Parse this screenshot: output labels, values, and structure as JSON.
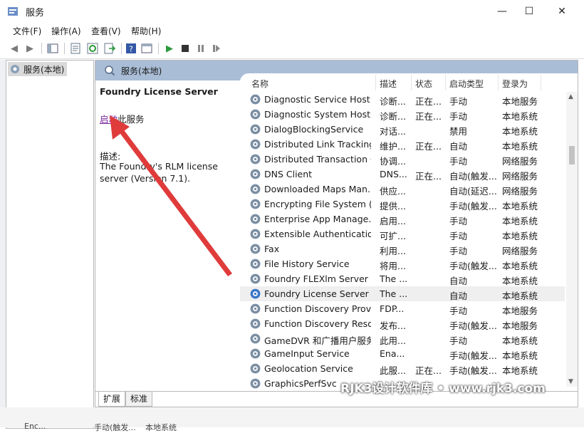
{
  "window": {
    "title": "服务",
    "minimize_glyph": "—",
    "maximize_glyph": "☐",
    "close_glyph": "✕"
  },
  "menu": [
    {
      "label": "文件(F)"
    },
    {
      "label": "操作(A)"
    },
    {
      "label": "查看(V)"
    },
    {
      "label": "帮助(H)"
    }
  ],
  "toolbar": {
    "icons": [
      "back-arrow-icon",
      "forward-arrow-icon",
      "console-tree-icon",
      "properties-icon",
      "refresh-icon",
      "export-list-icon",
      "help-icon",
      "view-icon",
      "start-service-icon",
      "stop-service-icon",
      "pause-service-icon",
      "restart-service-icon"
    ]
  },
  "tree": {
    "root_label": "服务(本地)"
  },
  "main": {
    "header_title": "服务(本地)",
    "detail": {
      "service_name": "Foundry License Server",
      "action_link": "启动",
      "action_suffix": "此服务",
      "desc_label": "描述:",
      "desc_text": "The Foundry's RLM license server (Version 7.1)."
    },
    "columns": {
      "name": "名称",
      "desc": "描述",
      "status": "状态",
      "startup": "启动类型",
      "logon": "登录为"
    },
    "rows": [
      {
        "name": "Diagnostic Service Host",
        "desc": "诊断...",
        "status": "正在...",
        "startup": "手动",
        "logon": "本地服务"
      },
      {
        "name": "Diagnostic System Host",
        "desc": "诊断...",
        "status": "正在...",
        "startup": "手动",
        "logon": "本地系统"
      },
      {
        "name": "DialogBlockingService",
        "desc": "对话...",
        "status": "",
        "startup": "禁用",
        "logon": "本地系统"
      },
      {
        "name": "Distributed Link Tracking...",
        "desc": "维护...",
        "status": "正在...",
        "startup": "自动",
        "logon": "本地系统"
      },
      {
        "name": "Distributed Transaction C...",
        "desc": "协调...",
        "status": "",
        "startup": "手动",
        "logon": "网络服务"
      },
      {
        "name": "DNS Client",
        "desc": "DNS...",
        "status": "正在...",
        "startup": "自动(触发...",
        "logon": "网络服务"
      },
      {
        "name": "Downloaded Maps Man...",
        "desc": "供应...",
        "status": "",
        "startup": "自动(延迟...",
        "logon": "网络服务"
      },
      {
        "name": "Encrypting File System (E...",
        "desc": "提供...",
        "status": "",
        "startup": "手动(触发...",
        "logon": "本地系统"
      },
      {
        "name": "Enterprise App Manage...",
        "desc": "启用...",
        "status": "",
        "startup": "手动",
        "logon": "本地系统"
      },
      {
        "name": "Extensible Authentication...",
        "desc": "可扩...",
        "status": "",
        "startup": "手动",
        "logon": "本地系统"
      },
      {
        "name": "Fax",
        "desc": "利用...",
        "status": "",
        "startup": "手动",
        "logon": "网络服务"
      },
      {
        "name": "File History Service",
        "desc": "将用...",
        "status": "",
        "startup": "手动(触发...",
        "logon": "本地系统"
      },
      {
        "name": "Foundry FLEXlm Server",
        "desc": "The ...",
        "status": "",
        "startup": "自动",
        "logon": "本地系统"
      },
      {
        "name": "Foundry License Server",
        "desc": "The ...",
        "status": "",
        "startup": "自动",
        "logon": "本地系统",
        "selected": true
      },
      {
        "name": "Function Discovery Provi...",
        "desc": "FDP...",
        "status": "",
        "startup": "手动",
        "logon": "本地服务"
      },
      {
        "name": "Function Discovery Reso...",
        "desc": "发布...",
        "status": "",
        "startup": "手动(触发...",
        "logon": "本地服务"
      },
      {
        "name": "GameDVR 和广播用户服务...",
        "desc": "此用...",
        "status": "",
        "startup": "手动",
        "logon": "本地系统"
      },
      {
        "name": "GameInput Service",
        "desc": "Ena...",
        "status": "",
        "startup": "手动(触发...",
        "logon": "本地系统"
      },
      {
        "name": "Geolocation Service",
        "desc": "此服...",
        "status": "正在...",
        "startup": "手动(触发...",
        "logon": "本地系统"
      },
      {
        "name": "GraphicsPerfSvc",
        "desc": "",
        "status": "",
        "startup": "",
        "logon": ""
      }
    ],
    "tabs": [
      {
        "label": "扩展"
      },
      {
        "label": "标准"
      }
    ]
  },
  "statusbar": {
    "cells": [
      "Enc...",
      "手动(触发...",
      "本地系统"
    ]
  },
  "watermark": "RJK3设计软件库 • www.rjk3.com",
  "colors": {
    "header_bg": "#a9bdd6",
    "link": "#7a2aa0",
    "arrow": "#e03b3b",
    "selected_row": "#efefef"
  }
}
